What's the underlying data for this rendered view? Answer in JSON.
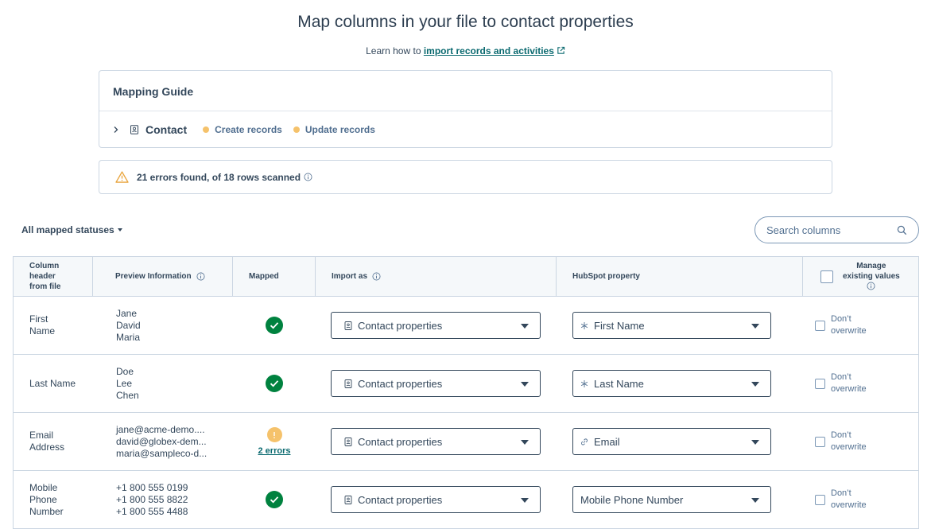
{
  "page": {
    "title": "Map columns in your file to contact properties",
    "learn_prefix": "Learn how to ",
    "learn_link": "import records and activities"
  },
  "guide": {
    "title": "Mapping Guide",
    "object_label": "Contact",
    "create_label": "Create records",
    "update_label": "Update records",
    "dot_color": "#f5c26b"
  },
  "errors_summary": "21 errors found, of 18 rows scanned",
  "filter": {
    "label": "All mapped statuses"
  },
  "search": {
    "placeholder": "Search columns"
  },
  "table": {
    "headers": {
      "column_header": [
        "Column",
        "header",
        "from file"
      ],
      "preview": "Preview Information",
      "mapped": "Mapped",
      "import_as": "Import as",
      "hubspot_property": "HubSpot property",
      "manage": [
        "Manage",
        "existing values"
      ]
    },
    "rows": [
      {
        "column": [
          "First",
          "Name"
        ],
        "preview": [
          "Jane",
          "David",
          "Maria"
        ],
        "mapped": "ok",
        "import_as": "Contact properties",
        "property": "First Name",
        "property_icon": "asterisk-icon",
        "dont_overwrite": [
          "Don’t",
          "overwrite"
        ]
      },
      {
        "column": [
          "Last Name"
        ],
        "preview": [
          "Doe",
          "Lee",
          "Chen"
        ],
        "mapped": "ok",
        "import_as": "Contact properties",
        "property": "Last Name",
        "property_icon": "asterisk-icon",
        "dont_overwrite": [
          "Don’t",
          "overwrite"
        ]
      },
      {
        "column": [
          "Email",
          "Address"
        ],
        "preview": [
          "jane@acme-demo....",
          "david@globex-dem...",
          "maria@sampleco-d..."
        ],
        "mapped": "warning",
        "errors_label": "2 errors",
        "import_as": "Contact properties",
        "property": "Email",
        "property_icon": "link-icon",
        "dont_overwrite": [
          "Don’t",
          "overwrite"
        ]
      },
      {
        "column": [
          "Mobile",
          "Phone",
          "Number"
        ],
        "preview": [
          "+1 800 555 0199",
          "+1 800 555 8822",
          "+1 800 555 4488"
        ],
        "mapped": "ok",
        "import_as": "Contact properties",
        "property": "Mobile Phone Number",
        "property_icon": "",
        "dont_overwrite": [
          "Don’t",
          "overwrite"
        ]
      }
    ]
  },
  "colors": {
    "success": "#00823f",
    "warning": "#f5c26b",
    "link": "#0b6a70"
  }
}
